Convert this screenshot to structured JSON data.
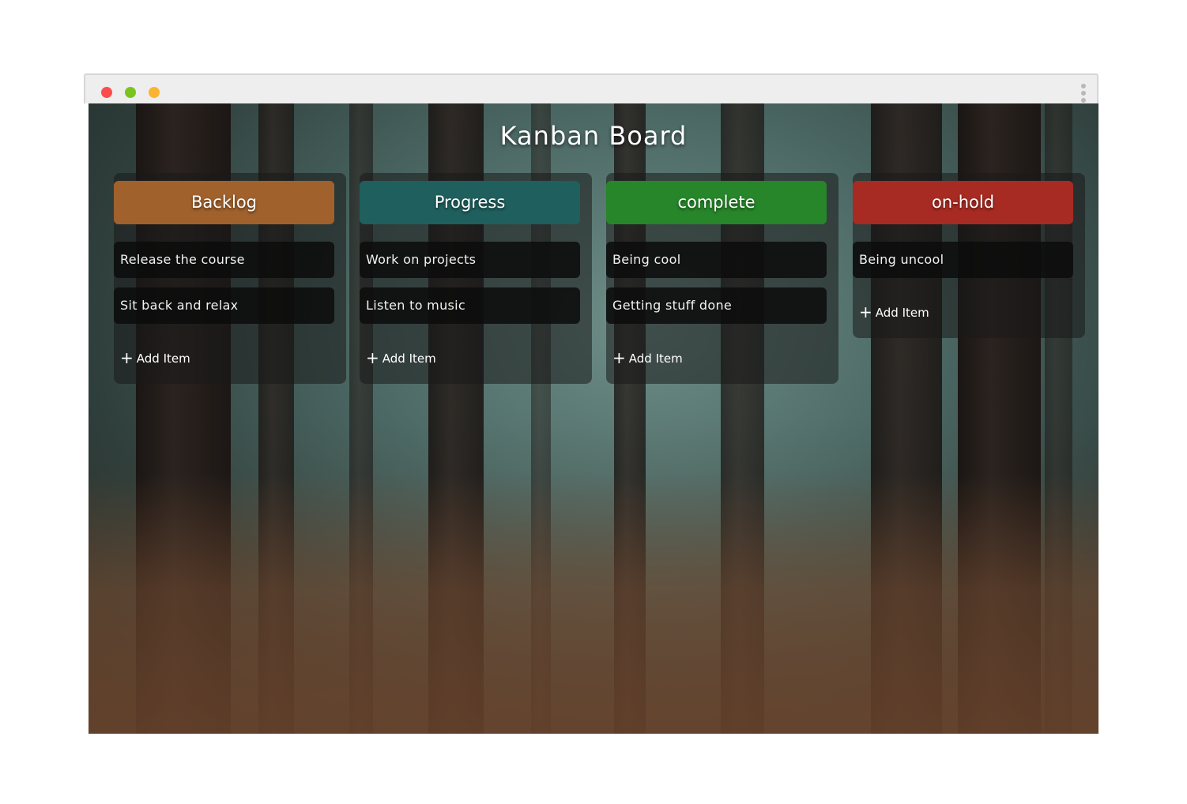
{
  "board": {
    "title": "Kanban Board",
    "add_label": "Add Item",
    "columns": [
      {
        "name": "Backlog",
        "color": "#a0612c",
        "items": [
          "Release the course",
          "Sit back and relax"
        ]
      },
      {
        "name": "Progress",
        "color": "#1f5f5d",
        "items": [
          "Work on projects",
          "Listen to music"
        ]
      },
      {
        "name": "complete",
        "color": "#27852a",
        "items": [
          "Being cool",
          "Getting stuff done"
        ]
      },
      {
        "name": "on-hold",
        "color": "#a72b22",
        "items": [
          "Being uncool"
        ]
      }
    ]
  },
  "window_controls": {
    "close_color": "#fc4d4d",
    "minimize_color": "#7ac41e",
    "maximize_color": "#fcb430"
  }
}
